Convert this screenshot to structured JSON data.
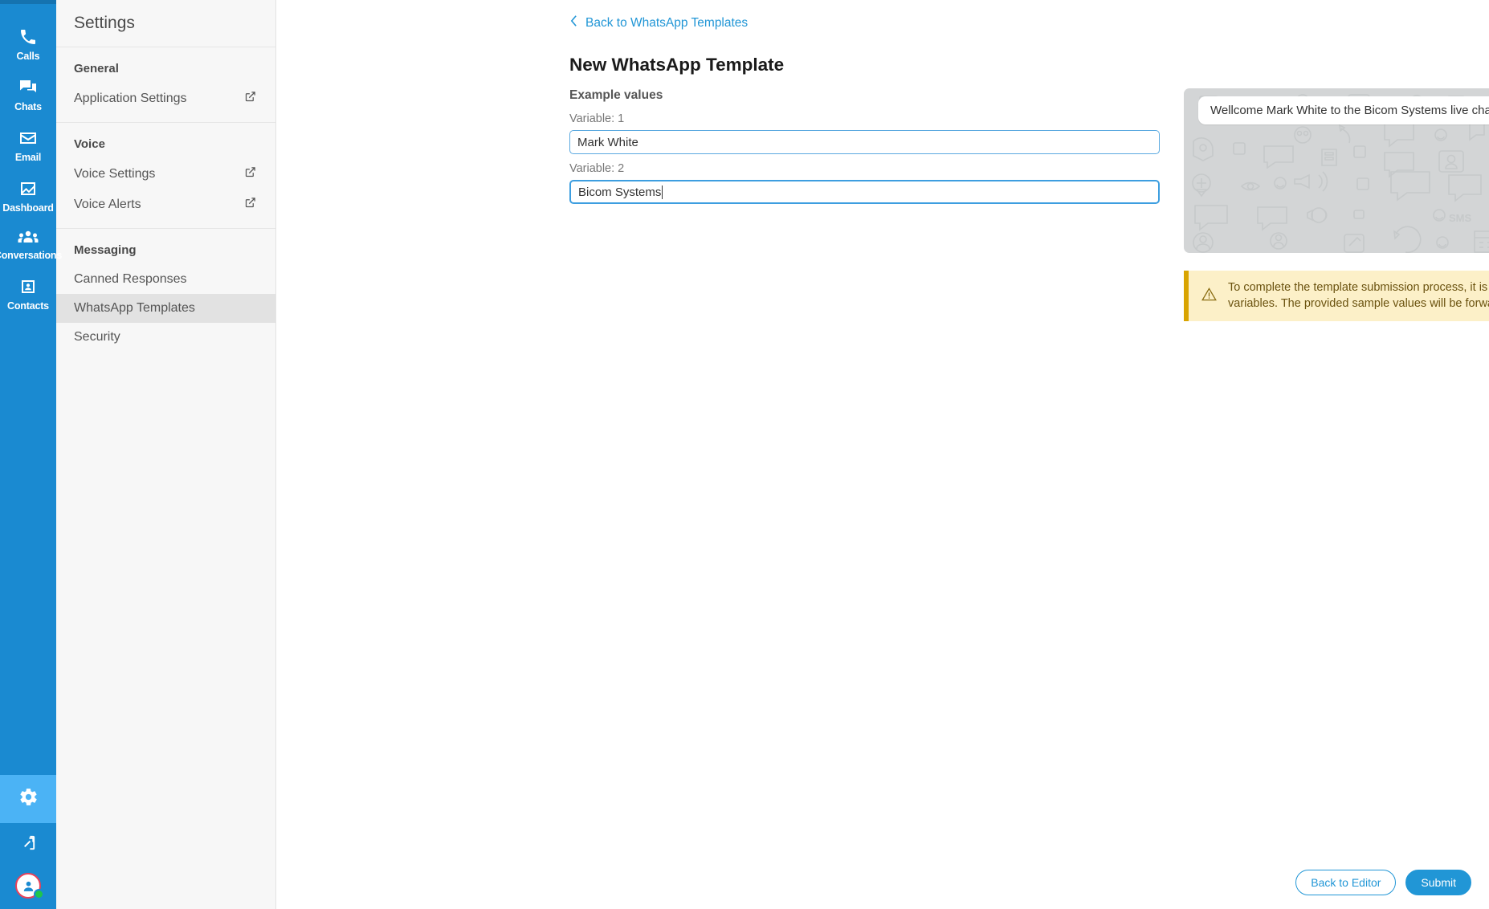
{
  "rail": {
    "items": [
      {
        "label": "Calls",
        "icon": "phone-icon"
      },
      {
        "label": "Chats",
        "icon": "chat-bubbles-icon"
      },
      {
        "label": "Email",
        "icon": "envelope-icon"
      },
      {
        "label": "Dashboard",
        "icon": "dashboard-icon"
      },
      {
        "label": "Conversations",
        "icon": "people-group-icon"
      },
      {
        "label": "Contacts",
        "icon": "contact-card-icon"
      }
    ],
    "bottom": {
      "settings_icon": "gear-icon",
      "logout_icon": "logout-icon",
      "avatar_icon": "user-avatar-icon",
      "presence": "online"
    }
  },
  "settings_sidebar": {
    "title": "Settings",
    "groups": [
      {
        "heading": "General",
        "items": [
          {
            "label": "Application Settings",
            "external": true,
            "active": false
          }
        ]
      },
      {
        "heading": "Voice",
        "items": [
          {
            "label": "Voice Settings",
            "external": true,
            "active": false
          },
          {
            "label": "Voice Alerts",
            "external": true,
            "active": false
          }
        ]
      },
      {
        "heading": "Messaging",
        "items": [
          {
            "label": "Canned Responses",
            "external": false,
            "active": false
          },
          {
            "label": "WhatsApp Templates",
            "external": false,
            "active": true
          },
          {
            "label": "Security",
            "external": false,
            "active": false
          }
        ]
      }
    ]
  },
  "main": {
    "back_link": "Back to WhatsApp Templates",
    "page_title": "New WhatsApp Template",
    "section_label": "Example values",
    "fields": [
      {
        "label": "Variable: 1",
        "value": "Mark White",
        "focused": false
      },
      {
        "label": "Variable: 2",
        "value": "Bicom Systems",
        "focused": true
      }
    ]
  },
  "preview": {
    "message": "Wellcome Mark White to the Bicom Systems live chat"
  },
  "warning": {
    "icon": "warning-triangle-icon",
    "text": "To complete the template submission process, it is mandatory to include example values for all variables. The provided sample values will be forwarded to Meta as part of the submission."
  },
  "footer": {
    "back_to_editor": "Back to Editor",
    "submit": "Submit"
  },
  "colors": {
    "rail_blue": "#1a8ad1",
    "rail_blue_dark": "#1573b0",
    "gear_highlight": "#4bb3f5",
    "accent_link": "#2196d6",
    "warning_bg": "#fcf0c8",
    "warning_border": "#d9a400",
    "warning_text": "#6b5310",
    "preview_bg": "#d3d5d6",
    "sidebar_bg": "#f7f7f7",
    "sidebar_active": "#e2e2e2",
    "presence_green": "#1ec64a",
    "avatar_ring": "#e8415a"
  }
}
